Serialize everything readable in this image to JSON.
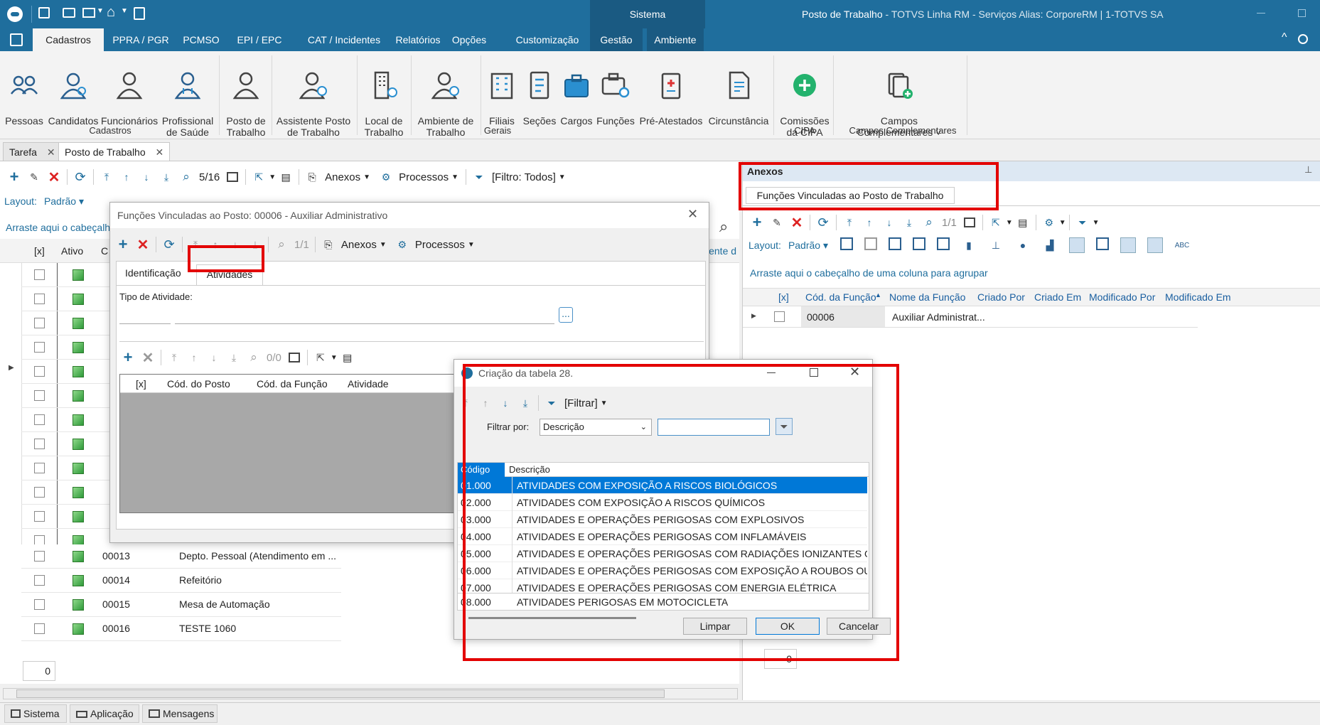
{
  "window": {
    "center_title": "Sistema",
    "app_title": "Posto de Trabalho",
    "app_subtitle": "- TOTVS Linha RM - Serviços  Alias: CorporeRM | 1-TOTVS SA"
  },
  "ribbon_tabs": [
    "Cadastros",
    "PPRA / PGR",
    "PCMSO",
    "EPI / EPC",
    "CAT / Incidentes",
    "Relatórios",
    "Opções",
    "Customização",
    "Gestão",
    "Ambiente"
  ],
  "ribbon": {
    "buttons": [
      {
        "label": "Pessoas"
      },
      {
        "label": "Candidatos"
      },
      {
        "label": "Funcionários"
      },
      {
        "label": "Profissional\nde Saúde"
      },
      {
        "label": "Posto de\nTrabalho"
      },
      {
        "label": "Assistente Posto\nde Trabalho"
      },
      {
        "label": "Local de\nTrabalho"
      },
      {
        "label": "Ambiente de\nTrabalho"
      },
      {
        "label": "Filiais"
      },
      {
        "label": "Seções"
      },
      {
        "label": "Cargos"
      },
      {
        "label": "Funções"
      },
      {
        "label": "Pré-Atestados"
      },
      {
        "label": "Circunstância"
      },
      {
        "label": "Comissões\nda CIPA"
      },
      {
        "label": "Campos\nComplementares ˅"
      }
    ],
    "groups": [
      "Cadastros",
      "Gerais",
      "CIPA",
      "Campos Complementares"
    ]
  },
  "page_tabs": [
    "Tarefa",
    "Posto de Trabalho"
  ],
  "main_toolbar": {
    "counter": "5/16",
    "anexos": "Anexos",
    "processos": "Processos",
    "filter": "[Filtro: Todos]"
  },
  "layout_bar": {
    "label": "Layout:",
    "value": "Padrão ▾"
  },
  "group_hint": "Arraste aqui o cabeçalho",
  "main_grid": {
    "headers": [
      "[x]",
      "Ativo",
      "C"
    ],
    "visible_rows": [
      {
        "code": "00013",
        "name": "Depto. Pessoal (Atendimento em ..."
      },
      {
        "code": "00014",
        "name": "Refeitório"
      },
      {
        "code": "00015",
        "name": "Mesa de Automação"
      },
      {
        "code": "00016",
        "name": "TESTE 1060"
      }
    ],
    "partial_header": "iente d",
    "footer_count": "0"
  },
  "anexos_panel": {
    "title": "Anexos",
    "tab": "Funções Vinculadas ao Posto de Trabalho",
    "counter": "1/1",
    "layout_label": "Layout:",
    "layout_value": "Padrão ▾",
    "group_hint": "Arraste aqui o cabeçalho de uma coluna para agrupar",
    "headers": [
      "[x]",
      "Cód. da Função",
      "Nome da Função",
      "Criado Por",
      "Criado Em",
      "Modificado Por",
      "Modificado Em"
    ],
    "row": {
      "code": "00006",
      "name": "Auxiliar Administrat..."
    },
    "footer_count": "0"
  },
  "func_window": {
    "title": "Funções Vinculadas ao Posto: 00006 - Auxiliar Administrativo",
    "counter": "1/1",
    "anexos": "Anexos",
    "processos": "Processos",
    "tabs": [
      "Identificação",
      "Atividades"
    ],
    "field_label": "Tipo de Atividade:",
    "lookup_button": "...",
    "sub_counter": "0/0",
    "grid_headers": [
      "[x]",
      "Cód. do Posto",
      "Cód. da Função",
      "Atividade"
    ]
  },
  "table_dialog": {
    "title": "Criação da tabela 28.",
    "filter_button": "[Filtrar]",
    "filter_by_label": "Filtrar por:",
    "filter_by_value": "Descrição",
    "search_value": "",
    "headers": [
      "Código",
      "Descrição"
    ],
    "rows": [
      {
        "code": "01.000",
        "desc": "ATIVIDADES COM EXPOSIÇÃO A RISCOS BIOLÓGICOS"
      },
      {
        "code": "02.000",
        "desc": "ATIVIDADES COM EXPOSIÇÃO A RISCOS QUÍMICOS"
      },
      {
        "code": "03.000",
        "desc": "ATIVIDADES E OPERAÇÕES PERIGOSAS COM EXPLOSIVOS"
      },
      {
        "code": "04.000",
        "desc": "ATIVIDADES E OPERAÇÕES PERIGOSAS COM INFLAMÁVEIS"
      },
      {
        "code": "05.000",
        "desc": "ATIVIDADES E OPERAÇÕES PERIGOSAS COM RADIAÇÕES IONIZANTES OU SU"
      },
      {
        "code": "06.000",
        "desc": "ATIVIDADES E OPERAÇÕES PERIGOSAS COM EXPOSIÇÃO A ROUBOS OU OUT"
      },
      {
        "code": "07.000",
        "desc": "ATIVIDADES E OPERAÇÕES PERIGOSAS COM ENERGIA ELÉTRICA"
      },
      {
        "code": "08.000",
        "desc": "ATIVIDADES PERIGOSAS EM MOTOCICLETA"
      }
    ],
    "buttons": {
      "clear": "Limpar",
      "ok": "OK",
      "cancel": "Cancelar"
    }
  },
  "statusbar": [
    "Sistema",
    "Aplicação",
    "Mensagens"
  ],
  "colors": {
    "brand": "#1f6e9d",
    "selection": "#0078d7",
    "highlight": "#e30000"
  }
}
